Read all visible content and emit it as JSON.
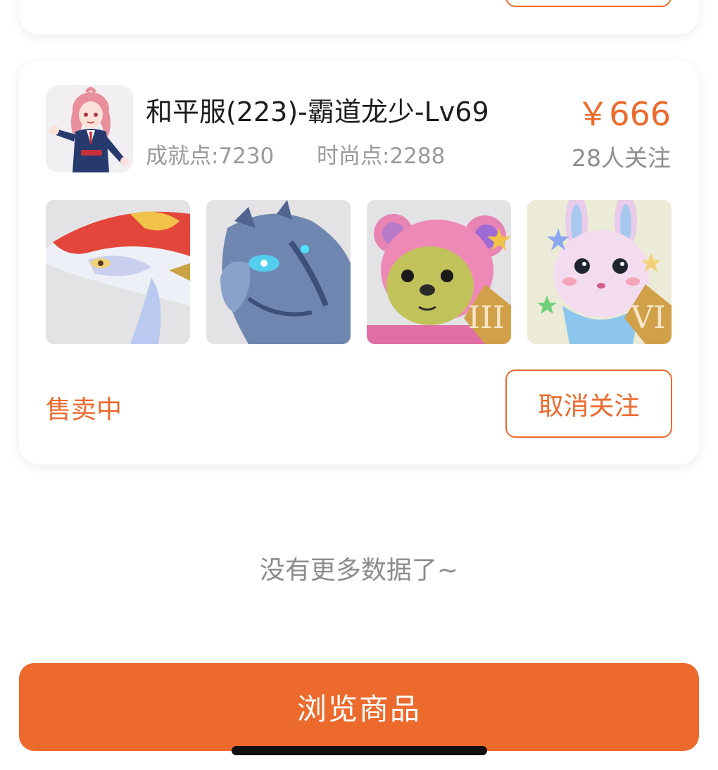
{
  "listing": {
    "title": "和平服(223)-霸道龙少-Lv69",
    "achievement_points": "成就点:7230",
    "fashion_points": "时尚点:2288",
    "price": "￥666",
    "followers": "28人关注",
    "status": "售卖中",
    "unfollow_label": "取消关注",
    "avatar_icon": "character-avatar",
    "thumbnails": [
      {
        "icon": "red-fish-mount-image"
      },
      {
        "icon": "blue-dragon-horse-mount-image"
      },
      {
        "icon": "pink-bear-pet-image",
        "badge": "III"
      },
      {
        "icon": "pink-bunny-pet-image",
        "badge": "VI"
      }
    ]
  },
  "footer": {
    "no_more_text": "没有更多数据了~",
    "browse_label": "浏览商品"
  },
  "colors": {
    "accent": "#ec6a2c",
    "title_text": "#1c1c1c",
    "muted_text": "#9a9a9a"
  }
}
